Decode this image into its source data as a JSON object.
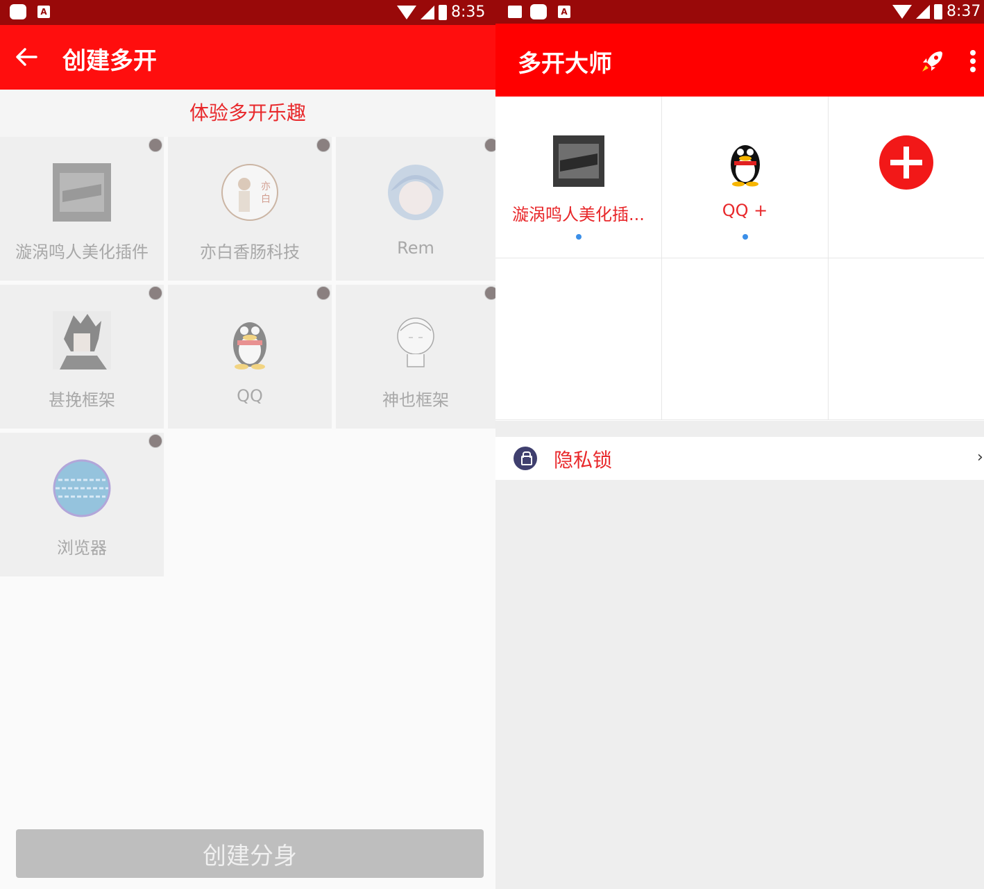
{
  "left": {
    "status": {
      "time": "8:35",
      "icons": [
        "app-icon",
        "a-icon",
        "wifi-icon",
        "signal-icon",
        "battery-icon"
      ]
    },
    "toolbar": {
      "title": "创建多开",
      "back_icon": "arrow-left-icon"
    },
    "subheader": "体验多开乐趣",
    "apps": [
      {
        "name": "漩涡鸣人美化插件",
        "icon": "naruto-avatar"
      },
      {
        "name": "亦白香肠科技",
        "icon": "yibai-avatar"
      },
      {
        "name": "Rem",
        "icon": "rem-avatar"
      },
      {
        "name": "甚挽框架",
        "icon": "sasuke-avatar"
      },
      {
        "name": "QQ",
        "icon": "qq-penguin-icon"
      },
      {
        "name": "神也框架",
        "icon": "sketch-avatar"
      },
      {
        "name": "浏览器",
        "icon": "globe-icon"
      }
    ],
    "create_button": "创建分身"
  },
  "right": {
    "status": {
      "time": "8:37",
      "icons": [
        "image-icon",
        "app-icon",
        "a-icon",
        "wifi-icon",
        "signal-icon",
        "battery-icon"
      ]
    },
    "toolbar": {
      "title": "多开大师",
      "rocket_icon": "rocket-icon",
      "more_icon": "more-vert-icon"
    },
    "clones": [
      {
        "name": "漩涡鸣人美化插...",
        "icon": "naruto-avatar"
      },
      {
        "name": "QQ +",
        "icon": "qq-penguin-icon"
      }
    ],
    "privacy": {
      "label": "隐私锁",
      "icon": "lock-icon"
    }
  },
  "colors": {
    "statusbar": "#990909",
    "toolbar_left": "#ff0e0e",
    "toolbar_right": "#ff0000",
    "accent_text": "#e8282b",
    "dot": "#3b8fe8",
    "add": "#f21818"
  }
}
